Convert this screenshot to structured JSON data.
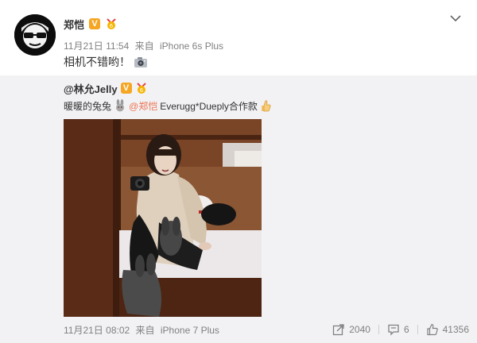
{
  "post": {
    "author": "郑恺",
    "timestamp": "11月21日 11:54",
    "source_prefix": "来自",
    "device": "iPhone 6s Plus",
    "text": "相机不错哟！",
    "emoji": "camera-icon"
  },
  "repost": {
    "author": "@林允Jelly",
    "text_prefix": "暖暖的兔兔",
    "mention": "@郑恺",
    "text_suffix": "Everugg*Dueply合作款",
    "timestamp": "11月21日 08:02",
    "source_prefix": "来自",
    "device": "iPhone 7 Plus",
    "actions": {
      "share_count": "2040",
      "comment_count": "6",
      "like_count": "41356"
    }
  },
  "colors": {
    "accent_verified": "#f5a623",
    "mention": "#eb7350",
    "repost_bg": "#f2f2f5",
    "meta_text": "#808080"
  }
}
